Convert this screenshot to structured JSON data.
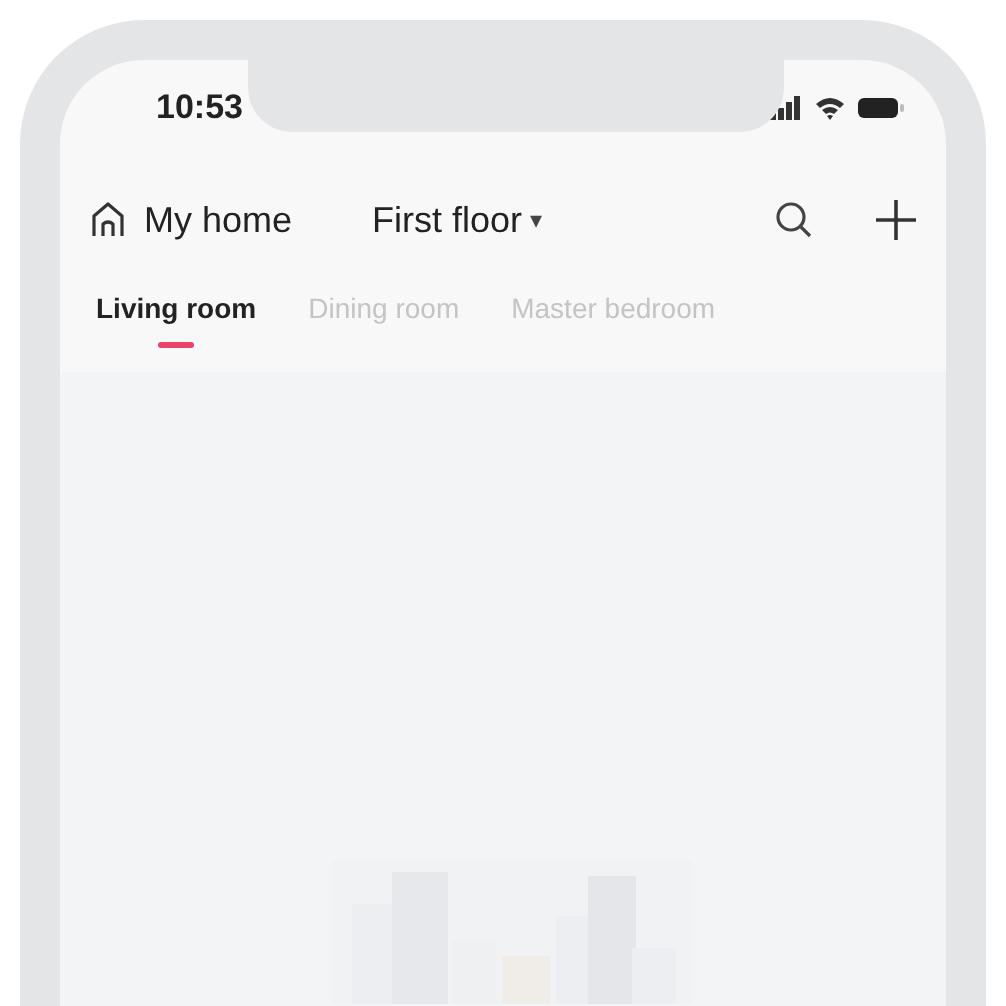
{
  "status_bar": {
    "time": "10:53"
  },
  "header": {
    "home": "My home",
    "floor": "First floor",
    "floor_caret": "▾"
  },
  "tabs": [
    {
      "label": "Living room",
      "selected": true
    },
    {
      "label": "Dining room",
      "selected": false
    },
    {
      "label": "Master bedroom",
      "selected": false
    }
  ]
}
